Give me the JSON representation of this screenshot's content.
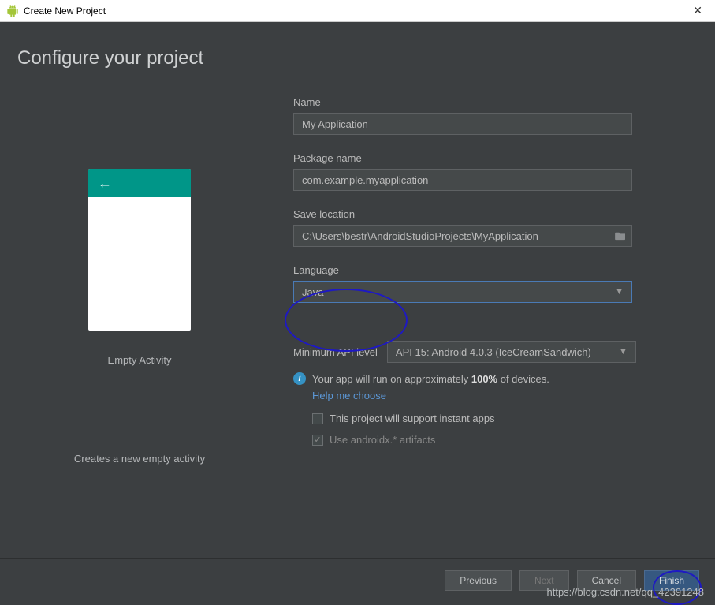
{
  "window": {
    "title": "Create New Project"
  },
  "heading": "Configure your project",
  "preview": {
    "activity_name": "Empty Activity",
    "description": "Creates a new empty activity"
  },
  "form": {
    "name_label": "Name",
    "name_value": "My Application",
    "package_label": "Package name",
    "package_value": "com.example.myapplication",
    "save_label": "Save location",
    "save_value": "C:\\Users\\bestr\\AndroidStudioProjects\\MyApplication",
    "language_label": "Language",
    "language_value": "Java",
    "api_label": "Minimum API level",
    "api_value": "API 15: Android 4.0.3 (IceCreamSandwich)",
    "info_prefix": "Your app will run on approximately ",
    "info_percent": "100%",
    "info_suffix": " of devices.",
    "help_link": "Help me choose",
    "instant_apps_label": "This project will support instant apps",
    "androidx_label": "Use androidx.* artifacts"
  },
  "buttons": {
    "previous": "Previous",
    "next": "Next",
    "cancel": "Cancel",
    "finish": "Finish"
  },
  "watermark": "https://blog.csdn.net/qq_42391248"
}
